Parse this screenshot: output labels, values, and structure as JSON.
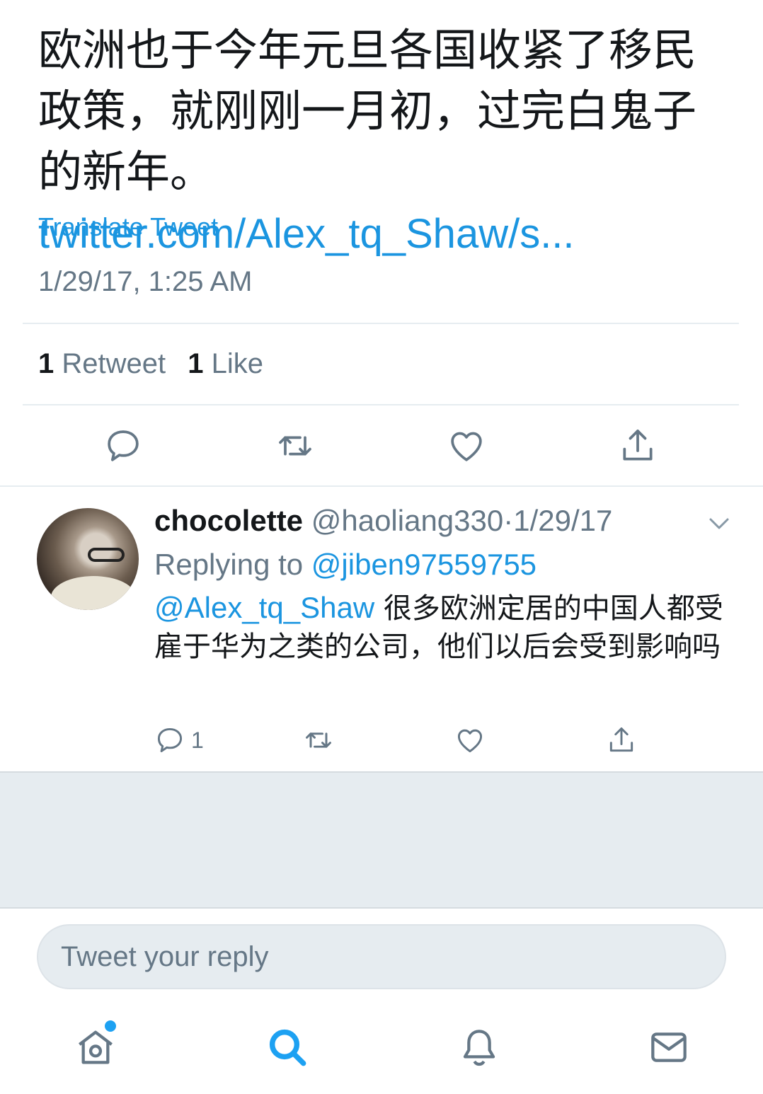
{
  "tweet": {
    "text": "欧洲也于今年元旦各国收紧了移民政策，就刚刚一月初，过完白鬼子的新年。",
    "link": "twitter.com/Alex_tq_Shaw/s...",
    "translate_label": "Translate Tweet",
    "timestamp": "1/29/17, 1:25 AM",
    "retweet_count": "1",
    "retweet_label": "Retweet",
    "like_count": "1",
    "like_label": "Like"
  },
  "reply": {
    "name": "chocolette",
    "handle": "@haoliang330",
    "separator": "·",
    "date": "1/29/17",
    "replying_prefix": "Replying to",
    "replying_to": "@jiben97559755",
    "mention": "@Alex_tq_Shaw",
    "text": "很多欧洲定居的中国人都受雇于华为之类的公司，他们以后会受到影响吗",
    "reply_count": "1"
  },
  "composer": {
    "placeholder": "Tweet your reply"
  },
  "colors": {
    "accent": "#1b95e0",
    "secondary_text": "#657786",
    "divider": "#e6ecf0"
  },
  "icons": {
    "actions": [
      "reply-icon",
      "retweet-icon",
      "like-icon",
      "share-icon"
    ],
    "tabs": [
      "home-icon",
      "search-icon",
      "notifications-icon",
      "messages-icon"
    ]
  }
}
